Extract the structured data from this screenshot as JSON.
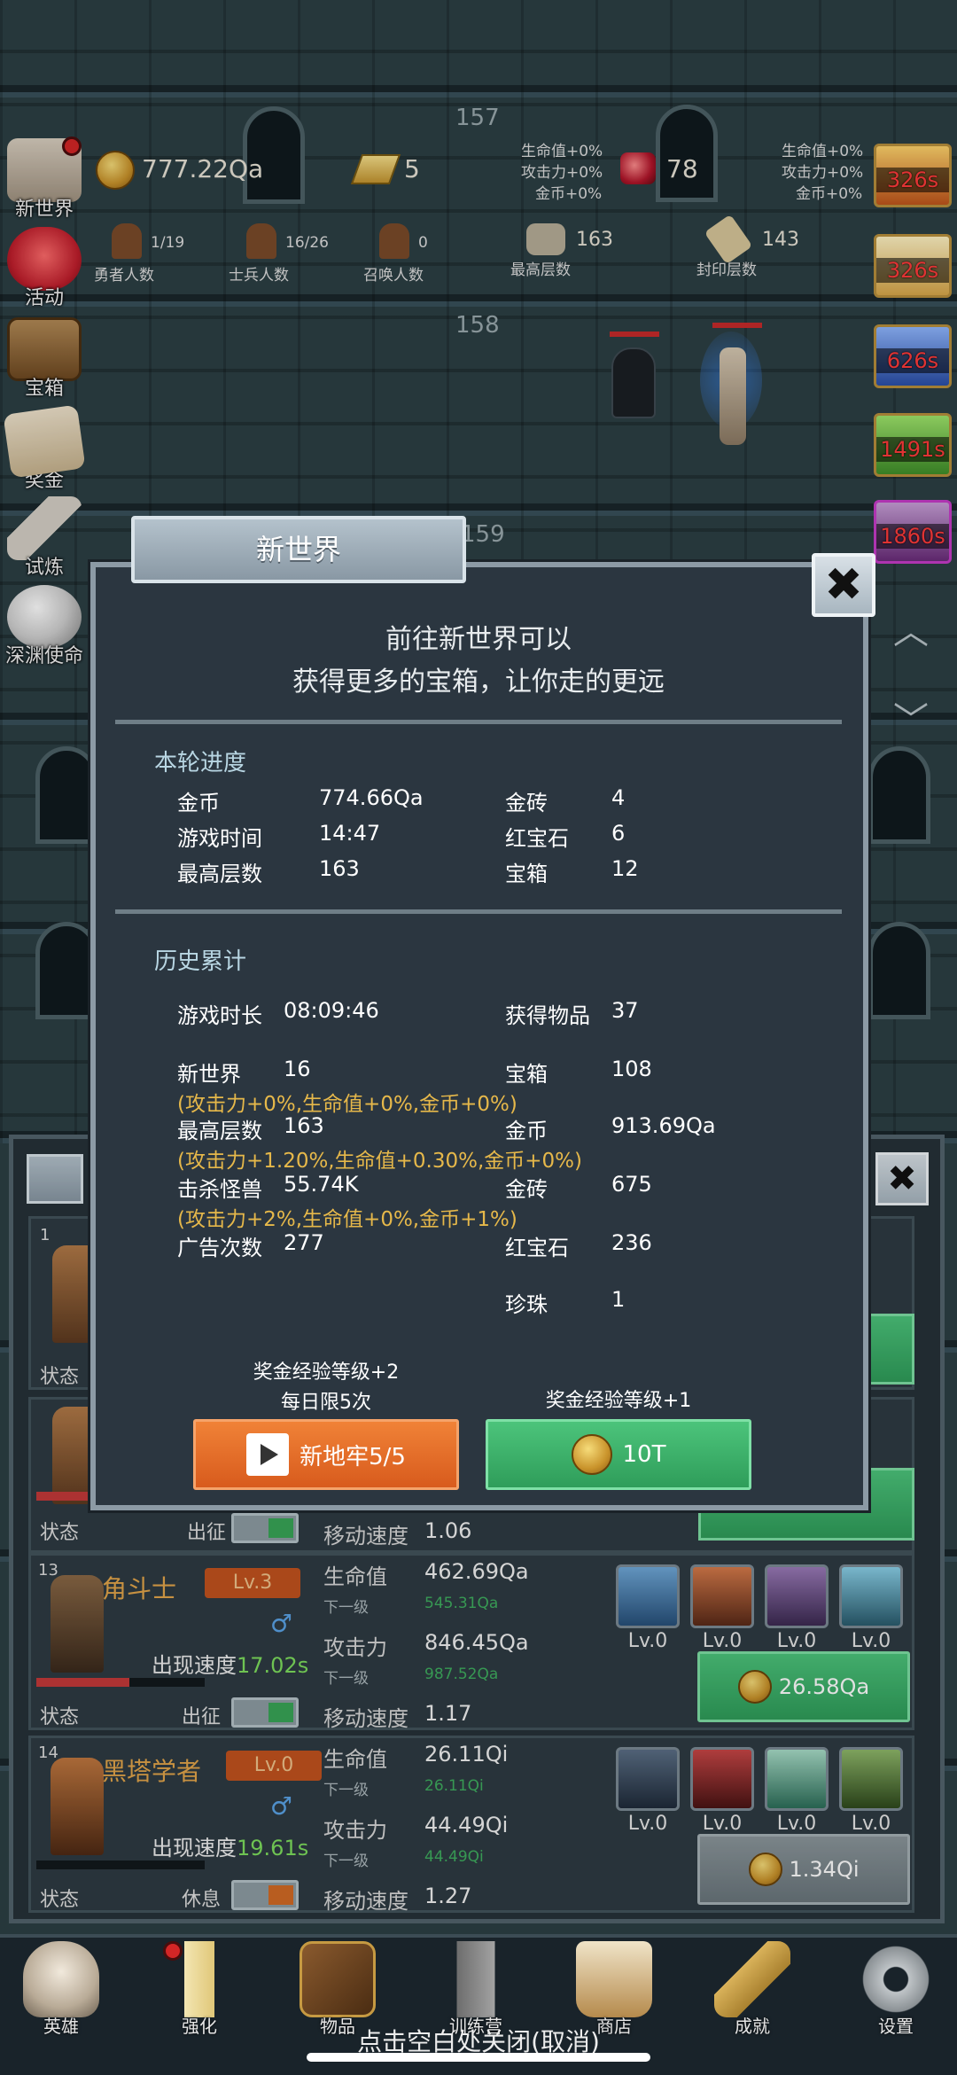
{
  "floors": {
    "f157": "157",
    "f158": "158",
    "f159": "159"
  },
  "topbar": {
    "gold": "777.22Qa",
    "gold_bars": "5",
    "rubies": "78",
    "bonus_left": [
      "生命值+0%",
      "攻击力+0%",
      "金币+0%"
    ],
    "bonus_right": [
      "生命值+0%",
      "攻击力+0%",
      "金币+0%"
    ],
    "hero_count": "1/19",
    "hero_label": "勇者人数",
    "soldier_count": "16/26",
    "soldier_label": "士兵人数",
    "summon_count": "0",
    "summon_label": "召唤人数",
    "max_floor": "163",
    "max_floor_label": "最高层数",
    "seal_floor": "143",
    "seal_floor_label": "封印层数"
  },
  "left_menu": [
    "新世界",
    "活动",
    "宝箱",
    "奖金",
    "试炼",
    "深渊使命"
  ],
  "right_timers": [
    "326s",
    "326s",
    "626s",
    "1491s",
    "1860s"
  ],
  "modal": {
    "title": "新世界",
    "close": "✖",
    "intro_line1": "前往新世界可以",
    "intro_line2": "获得更多的宝箱，让你走的更远",
    "round_title": "本轮进度",
    "round": {
      "gold_k": "金币",
      "gold_v": "774.66Qa",
      "time_k": "游戏时间",
      "time_v": "14:47",
      "floor_k": "最高层数",
      "floor_v": "163",
      "bar_k": "金砖",
      "bar_v": "4",
      "ruby_k": "红宝石",
      "ruby_v": "6",
      "chest_k": "宝箱",
      "chest_v": "12"
    },
    "history_title": "历史累计",
    "history": {
      "playtime_k": "游戏时长",
      "playtime_v": "08:09:46",
      "items_k": "获得物品",
      "items_v": "37",
      "newworld_k": "新世界",
      "newworld_v": "16",
      "newworld_bonus": "(攻击力+0%,生命值+0%,金币+0%)",
      "chest_k": "宝箱",
      "chest_v": "108",
      "maxfloor_k": "最高层数",
      "maxfloor_v": "163",
      "maxfloor_bonus": "(攻击力+1.20%,生命值+0.30%,金币+0%)",
      "gold_k": "金币",
      "gold_v": "913.69Qa",
      "kills_k": "击杀怪兽",
      "kills_v": "55.74K",
      "kills_bonus": "(攻击力+2%,生命值+0%,金币+1%)",
      "bar_k": "金砖",
      "bar_v": "675",
      "ads_k": "广告次数",
      "ads_v": "277",
      "ruby_k": "红宝石",
      "ruby_v": "236",
      "pearl_k": "珍珠",
      "pearl_v": "1"
    },
    "ad_note1": "奖金经验等级+2",
    "ad_note2": "每日限5次",
    "coin_note": "奖金经验等级+1",
    "ad_button": "新地牢5/5",
    "coin_button": "10T"
  },
  "heroes": [
    {
      "num": "13",
      "name": "角斗士",
      "level": "Lv.3",
      "speed_label": "出现速度",
      "speed": "17.02s",
      "state_label": "状态",
      "state": "出征",
      "hp_label": "生命值",
      "hp": "462.69Qa",
      "next_label": "下一级",
      "hp_next": "545.31Qa",
      "atk_label": "攻击力",
      "atk": "846.45Qa",
      "atk_next": "987.52Qa",
      "move_label": "移动速度",
      "move": "1.17",
      "skills": [
        "Lv.0",
        "Lv.0",
        "Lv.0",
        "Lv.0"
      ],
      "cost": "26.58Qa",
      "hp_fill": 0.55
    },
    {
      "num": "14",
      "name": "黑塔学者",
      "level": "Lv.0",
      "speed_label": "出现速度",
      "speed": "19.61s",
      "state_label": "状态",
      "state": "休息",
      "hp_label": "生命值",
      "hp": "26.11Qi",
      "next_label": "下一级",
      "hp_next": "26.11Qi",
      "atk_label": "攻击力",
      "atk": "44.49Qi",
      "atk_next": "44.49Qi",
      "move_label": "移动速度",
      "move": "1.27",
      "skills": [
        "Lv.0",
        "Lv.0",
        "Lv.0",
        "Lv.0"
      ],
      "cost": "1.34Qi",
      "hp_fill": 0.0
    }
  ],
  "partial_card": {
    "state_label": "状态",
    "state": "出征",
    "move_label": "移动速度",
    "move": "1.06",
    "num": "1",
    "state_label_top": "状态"
  },
  "panel_close": "✖",
  "nav": [
    "英雄",
    "强化",
    "物品",
    "训练营",
    "商店",
    "成就",
    "设置"
  ],
  "hint": "点击空白处关闭(取消)"
}
